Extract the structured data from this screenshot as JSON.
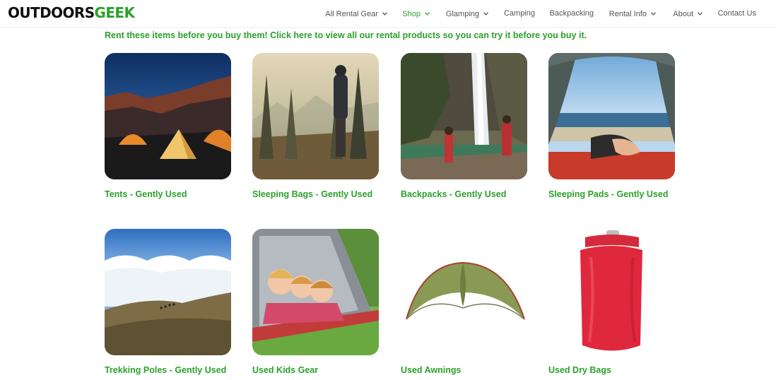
{
  "brand": {
    "logo_part1": "OUTDOORS",
    "logo_part2": "GEEK",
    "accent_color": "#2ba12b"
  },
  "nav": {
    "items": [
      {
        "label": "All Rental Gear",
        "has_dropdown": true,
        "active": false
      },
      {
        "label": "Shop",
        "has_dropdown": true,
        "active": true
      },
      {
        "label": "Glamping",
        "has_dropdown": true,
        "active": false
      },
      {
        "label": "Camping",
        "has_dropdown": false,
        "active": false
      },
      {
        "label": "Backpacking",
        "has_dropdown": false,
        "active": false
      },
      {
        "label": "Rental Info",
        "has_dropdown": true,
        "active": false
      },
      {
        "label": "About",
        "has_dropdown": true,
        "active": false
      },
      {
        "label": "Contact Us",
        "has_dropdown": false,
        "active": false
      }
    ],
    "dropdown_icon": "chevron-down-icon"
  },
  "promo_text": "Rent these items before you buy them! Click here to view all our rental products so you can try it before you buy it.",
  "products": [
    {
      "label": "Tents - Gently Used",
      "image": "tent-at-night-photo"
    },
    {
      "label": "Sleeping Bags - Gently Used",
      "image": "hiker-in-forest-photo"
    },
    {
      "label": "Backpacks - Gently Used",
      "image": "waterfall-hikers-photo"
    },
    {
      "label": "Sleeping Pads - Gently Used",
      "image": "tent-beach-view-photo"
    },
    {
      "label": "Trekking Poles - Gently Used",
      "image": "hikers-above-clouds-photo"
    },
    {
      "label": "Used Kids Gear",
      "image": "kids-in-tent-photo"
    },
    {
      "label": "Used Awnings",
      "image": "green-awning-photo"
    },
    {
      "label": "Used Dry Bags",
      "image": "red-dry-bag-photo"
    }
  ]
}
